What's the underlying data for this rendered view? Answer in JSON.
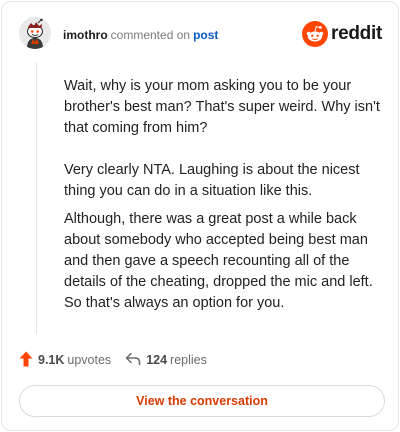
{
  "header": {
    "username": "imothro",
    "action_text": "commented on",
    "target_text": "post",
    "brand_wordmark": "reddit",
    "avatar_icon": "snoo-avatar-icon",
    "brand_icon": "reddit-logo-icon"
  },
  "comment": {
    "paragraphs": [
      "Wait, why is your mom asking you to be your brother's best man? That's super weird. Why isn't that coming from him?",
      "Very clearly NTA. Laughing is about the nicest thing you can do in a situation like this.",
      "Although, there was a great post a while back about somebody who accepted being best man and then gave a speech recounting all of the details of the cheating, dropped the mic and left. So that's always an option for you."
    ]
  },
  "stats": {
    "upvotes_count": "9.1K",
    "upvotes_label": "upvotes",
    "replies_count": "124",
    "replies_label": "replies",
    "upvote_icon": "upvote-arrow-icon",
    "reply_icon": "reply-arrow-icon"
  },
  "cta": {
    "label": "View the conversation"
  },
  "colors": {
    "accent": "#d93a00",
    "link": "#0a59c4",
    "reddit_orange": "#ff4500",
    "border": "#e3e5e7"
  }
}
